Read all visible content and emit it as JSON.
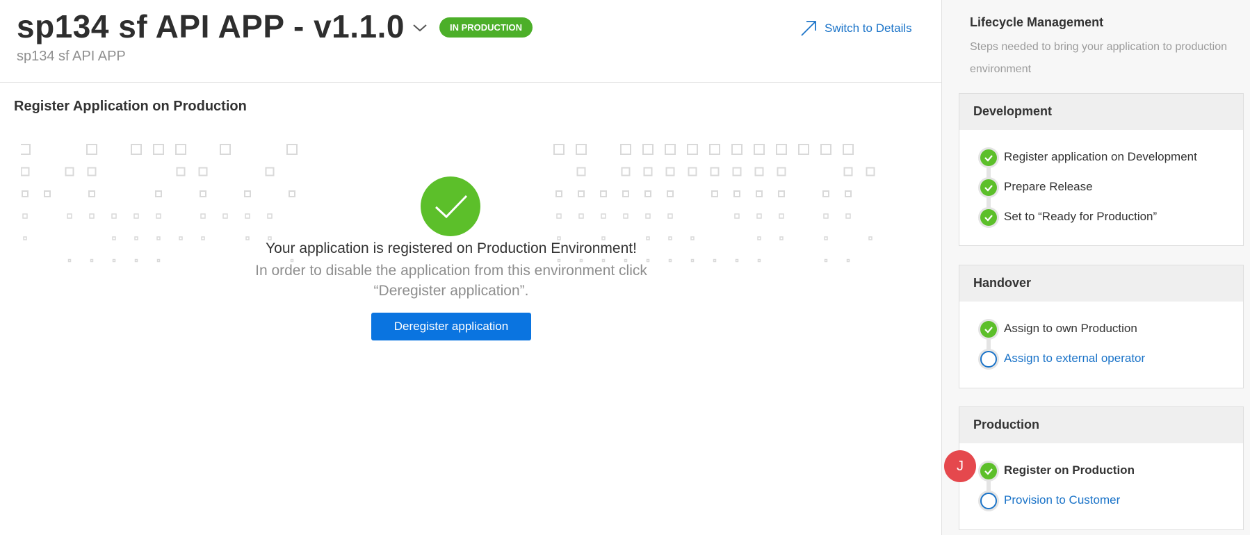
{
  "header": {
    "title": "sp134 sf API APP - v1.1.0",
    "status_badge": "IN PRODUCTION",
    "subtitle": "sp134 sf API APP",
    "switch_label": "Switch to Details"
  },
  "main": {
    "section_title": "Register Application on Production",
    "success_message": "Your application is registered on Production Environment!",
    "info_line1": "In order to disable the application from this environment click",
    "info_line2": "“Deregister application”.",
    "deregister_label": "Deregister application"
  },
  "sidebar": {
    "title": "Lifecycle Management",
    "description": "Steps needed to bring your application to production environment",
    "cards": [
      {
        "title": "Development",
        "steps": [
          {
            "label": "Register application on Development",
            "status": "done"
          },
          {
            "label": "Prepare Release",
            "status": "done"
          },
          {
            "label": "Set to “Ready for Production”",
            "status": "done"
          }
        ]
      },
      {
        "title": "Handover",
        "steps": [
          {
            "label": "Assign to own Production",
            "status": "done"
          },
          {
            "label": "Assign to external operator",
            "status": "todo"
          }
        ]
      },
      {
        "title": "Production",
        "steps": [
          {
            "label": "Register on Production",
            "status": "done"
          },
          {
            "label": "Provision to Customer",
            "status": "todo"
          }
        ]
      }
    ]
  },
  "user": {
    "initial": "J"
  },
  "colors": {
    "accent": "#1a73c8",
    "success": "#5cbf2a",
    "badge": "#4caf29",
    "primary_button": "#0a74e0",
    "avatar": "#e5484d"
  }
}
